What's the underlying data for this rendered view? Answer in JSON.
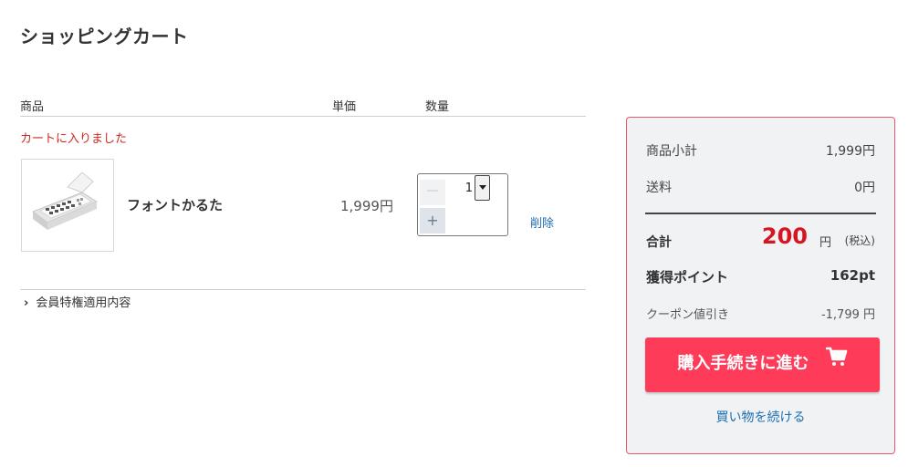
{
  "page": {
    "title": "ショッピングカート"
  },
  "cart": {
    "headers": {
      "product": "商品",
      "unit_price": "単価",
      "quantity": "数量"
    },
    "added_message": "カートに入りました",
    "item": {
      "name": "フォントかるた",
      "unit_price": "1,999円",
      "quantity": "1",
      "minus": "－",
      "plus": "+",
      "delete_label": "削除"
    },
    "member_benefits_label": "会員特権適用内容"
  },
  "summary": {
    "subtotal_label": "商品小計",
    "subtotal_value": "1,999円",
    "shipping_label": "送料",
    "shipping_value": "0円",
    "total_label": "合計",
    "total_value": "200",
    "total_unit": "円",
    "total_tax_note": "(税込)",
    "points_label": "獲得ポイント",
    "points_value": "162pt",
    "coupon_label": "クーポン値引き",
    "coupon_value": "-1,799 円",
    "checkout_label": "購入手続きに進む",
    "continue_label": "買い物を続ける"
  },
  "colors": {
    "accent": "#ff3b5a",
    "alert_red": "#d0281f",
    "total_red": "#d51621",
    "link_blue": "#1c6fb3",
    "summary_bg": "#f1f2f4"
  },
  "icons": [
    "product-thumbnail",
    "chevron-right-icon",
    "shopping-cart-icon",
    "dropdown-arrow-icon"
  ]
}
